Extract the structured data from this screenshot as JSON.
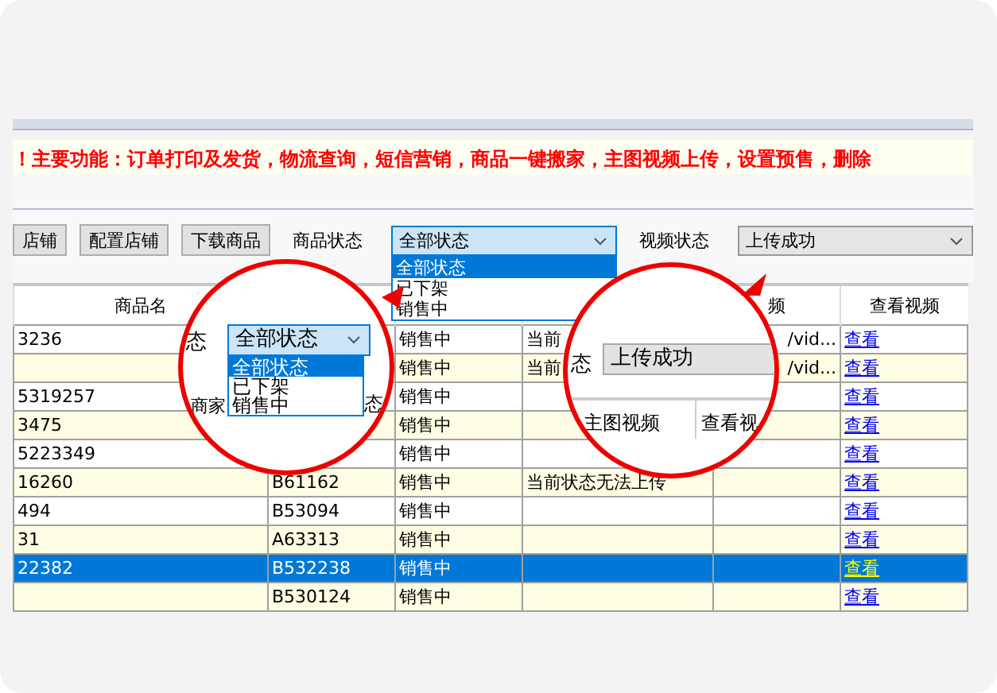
{
  "marquee": "！主要功能：订单打印及发货，物流查询，短信营销，商品一键搬家，主图视频上传，设置预售，删除",
  "toolbar": {
    "buttons": [
      "店铺",
      "配置店铺",
      "下载商品"
    ],
    "product_status": {
      "label": "商品状态",
      "value": "全部状态",
      "options": [
        {
          "label": "全部状态",
          "selected": true
        },
        {
          "label": "已下架",
          "selected": false
        },
        {
          "label": "销售中",
          "selected": false
        }
      ]
    },
    "video_status": {
      "label": "视频状态",
      "value": "上传成功"
    }
  },
  "table": {
    "columns": [
      {
        "label": "商品名"
      },
      {},
      {},
      {},
      {
        "label": "频"
      },
      {
        "label": "查看视频"
      }
    ],
    "rows": [
      {
        "cells": [
          "3236",
          null,
          "销售中",
          "当前",
          "/vid..."
        ],
        "link": "查看",
        "selected": false
      },
      {
        "cells": [
          null,
          null,
          "销售中",
          "当前",
          "/vid..."
        ],
        "link": "查看",
        "selected": false
      },
      {
        "cells": [
          "5319257",
          null,
          "销售中",
          null,
          null
        ],
        "link": "查看",
        "selected": false
      },
      {
        "cells": [
          "3475",
          null,
          "销售中",
          null,
          null
        ],
        "link": "查看",
        "selected": false
      },
      {
        "cells": [
          "5223349",
          null,
          "销售中",
          null,
          null
        ],
        "link": "查看",
        "selected": false
      },
      {
        "cells": [
          "16260",
          "B61162",
          "销售中",
          "当前状态无法上传",
          null
        ],
        "link": "查看",
        "selected": false
      },
      {
        "cells": [
          "494",
          "B53094",
          "销售中",
          null,
          null
        ],
        "link": "查看",
        "selected": false
      },
      {
        "cells": [
          "31",
          "A63313",
          "销售中",
          null,
          null
        ],
        "link": "查看",
        "selected": false
      },
      {
        "cells": [
          "22382",
          "B532238",
          "销售中",
          null,
          null
        ],
        "link": "查看",
        "selected": true
      },
      {
        "cells": [
          null,
          "B530124",
          "销售中",
          null,
          null
        ],
        "link": "查看",
        "selected": false
      }
    ]
  },
  "magnifiers": [
    {
      "kind": "dropdown",
      "label": "态",
      "value": "全部状态",
      "options": [
        {
          "label": "全部状态",
          "selected": true
        },
        {
          "label": "已下架",
          "selected": false
        },
        {
          "label": "销售中",
          "selected": false
        }
      ],
      "headers": [
        "商家",
        "态"
      ]
    },
    {
      "kind": "select",
      "label": "态",
      "value": "上传成功",
      "headers": [
        "主图视频",
        "查看视"
      ]
    }
  ]
}
